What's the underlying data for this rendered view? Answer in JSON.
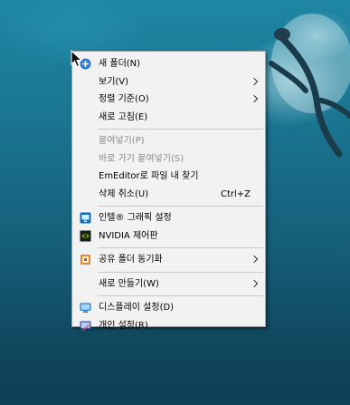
{
  "context_menu": {
    "items": [
      {
        "label": "새 폴더(N)",
        "icon": "new-folder-icon"
      },
      {
        "label": "보기(V)",
        "submenu": true
      },
      {
        "label": "정렬 기준(O)",
        "submenu": true
      },
      {
        "label": "새로 고침(E)"
      },
      {
        "label": "붙여넣기(P)",
        "disabled": true
      },
      {
        "label": "바로 가기 붙여넣기(S)",
        "disabled": true
      },
      {
        "label": "EmEditor로 파일 내 찾기"
      },
      {
        "label": "삭제 취소(U)",
        "shortcut": "Ctrl+Z"
      },
      {
        "label": "인텔® 그래픽 설정",
        "icon": "intel-graphics-icon"
      },
      {
        "label": "NVIDIA 제어판",
        "icon": "nvidia-icon"
      },
      {
        "label": "공유 폴더 동기화",
        "icon": "sync-folder-icon",
        "submenu": true
      },
      {
        "label": "새로 만들기(W)",
        "submenu": true
      },
      {
        "label": "디스플레이 설정(D)",
        "icon": "display-icon"
      },
      {
        "label": "개인 설정(R)",
        "icon": "personalize-icon"
      }
    ]
  },
  "colors": {
    "menu_background": "#f2f2f2",
    "disabled_text": "#8a8a8a",
    "desktop_water": "#1a7590"
  }
}
